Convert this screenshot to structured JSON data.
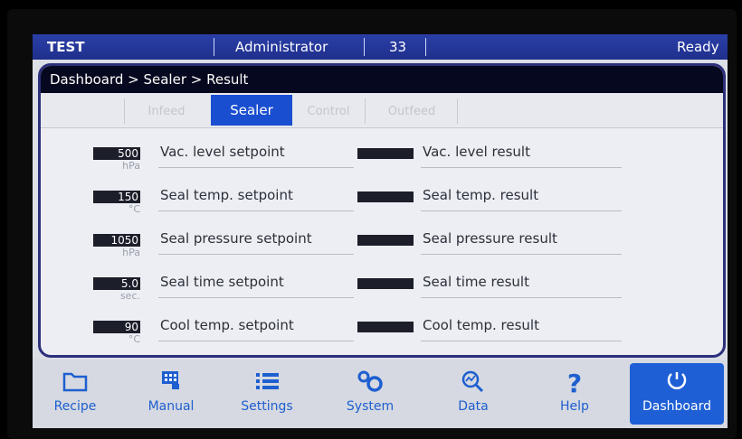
{
  "status": {
    "left": "TEST",
    "user": "Administrator",
    "number": "33",
    "state": "Ready"
  },
  "breadcrumb": "Dashboard > Sealer > Result",
  "tabs": [
    {
      "label": "Infeed"
    },
    {
      "label": "Sealer"
    },
    {
      "label": "Control"
    },
    {
      "label": "Outfeed"
    }
  ],
  "rows": [
    {
      "value": "500",
      "unit": "hPa",
      "setpoint": "Vac. level setpoint",
      "result": "Vac. level result"
    },
    {
      "value": "150",
      "unit": "°C",
      "setpoint": "Seal temp. setpoint",
      "result": "Seal temp. result"
    },
    {
      "value": "1050",
      "unit": "hPa",
      "setpoint": "Seal pressure setpoint",
      "result": "Seal pressure result"
    },
    {
      "value": "5.0",
      "unit": "sec.",
      "setpoint": "Seal time setpoint",
      "result": "Seal time result"
    },
    {
      "value": "90",
      "unit": "°C",
      "setpoint": "Cool temp. setpoint",
      "result": "Cool temp. result"
    }
  ],
  "nav": [
    {
      "label": "Recipe",
      "icon": "folder-icon"
    },
    {
      "label": "Manual",
      "icon": "hand-keypad-icon"
    },
    {
      "label": "Settings",
      "icon": "list-icon"
    },
    {
      "label": "System",
      "icon": "gears-icon"
    },
    {
      "label": "Data",
      "icon": "magnifier-chart-icon"
    },
    {
      "label": "Help",
      "icon": "question-icon"
    },
    {
      "label": "Dashboard",
      "icon": "power-gauge-icon"
    }
  ],
  "colors": {
    "status_bar": "#1f2f8c",
    "accent": "#1e5fd6",
    "breadcrumb_bg": "#06081f"
  }
}
